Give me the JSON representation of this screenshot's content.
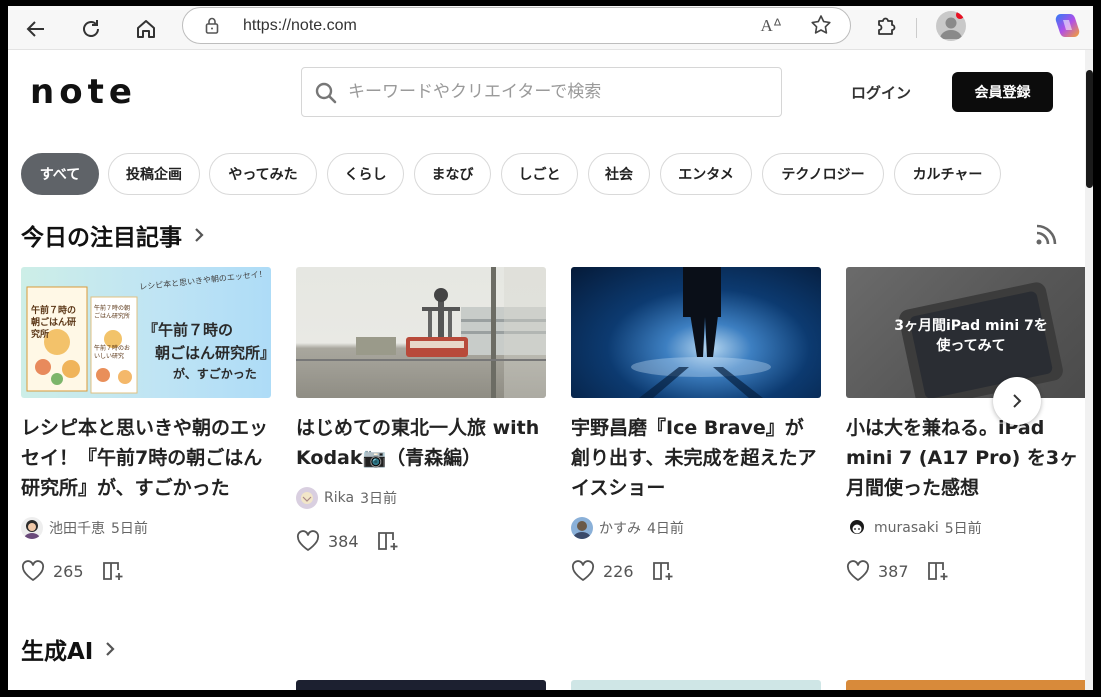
{
  "browser": {
    "url": "https://note.com",
    "read_aloud_label": "A"
  },
  "header": {
    "logo": "note",
    "search_placeholder": "キーワードやクリエイターで検索",
    "login_label": "ログイン",
    "signup_label": "会員登録"
  },
  "categories": [
    "すべて",
    "投稿企画",
    "やってみた",
    "くらし",
    "まなび",
    "しごと",
    "社会",
    "エンタメ",
    "テクノロジー",
    "カルチャー"
  ],
  "sections": {
    "featured_title": "今日の注目記事",
    "genai_title": "生成AI"
  },
  "articles": [
    {
      "title": "レシピ本と思いきや朝のエッセイ！『午前7時の朝ごはん研究所』が、すごかった",
      "thumb_text_1": "『午前７時の",
      "thumb_text_2": "朝ごはん研究所』",
      "thumb_text_3": "が、すごかった",
      "thumb_sub": "レシピ本と思いきや朝のエッセイ！",
      "book_title": "午前７時の朝ごはん研究所",
      "book_sub": "午前７時の朝ごはん研究所",
      "book_sub2": "午前７時のおいしい研究",
      "author": "池田千恵",
      "time": "5日前",
      "likes": "265"
    },
    {
      "title": "はじめての東北一人旅 with Kodak📷（青森編）",
      "author": "Rika",
      "time": "3日前",
      "likes": "384"
    },
    {
      "title": "宇野昌磨『Ice Brave』が創り出す、未完成を超えたアイスショー",
      "author": "かすみ",
      "time": "4日前",
      "likes": "226"
    },
    {
      "title": "小は大を兼ねる。iPad mini 7 (A17 Pro) を3ヶ月間使った感想",
      "thumb_text_1": "3ヶ月間iPad mini 7を",
      "thumb_text_2": "使ってみて",
      "author": "murasaki",
      "time": "5日前",
      "likes": "387"
    }
  ],
  "colors": {
    "accent_dark": "#0c0c0c",
    "pill_active": "#5f6368"
  }
}
